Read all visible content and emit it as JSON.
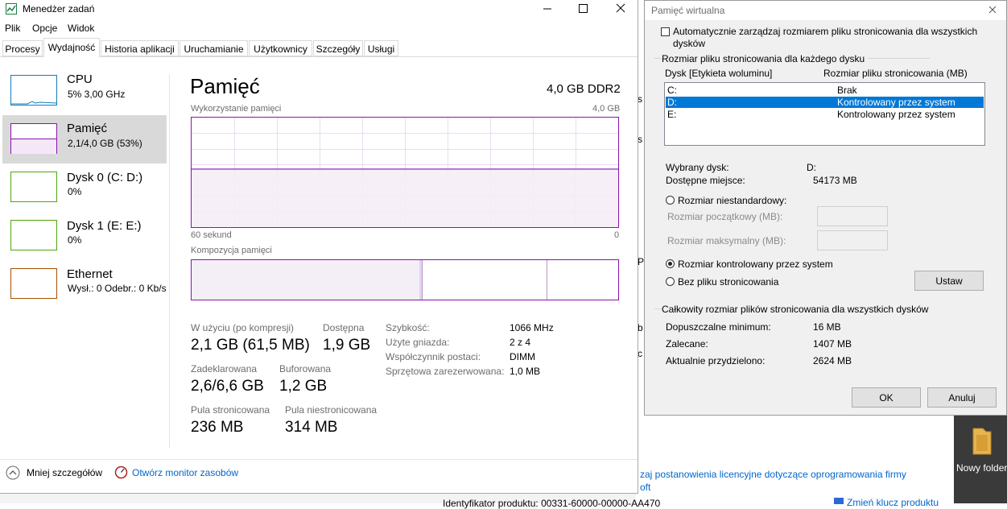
{
  "task_manager": {
    "title": "Menedżer zadań",
    "menu": [
      "Plik",
      "Opcje",
      "Widok"
    ],
    "tabs": [
      "Procesy",
      "Wydajność",
      "Historia aplikacji",
      "Uruchamianie",
      "Użytkownicy",
      "Szczegóły",
      "Usługi"
    ],
    "active_tab": "Wydajność",
    "sidebar": [
      {
        "name": "CPU",
        "detail": "5%  3,00 GHz",
        "color": "#117dbb"
      },
      {
        "name": "Pamięć",
        "detail": "2,1/4,0 GB (53%)",
        "color": "#8b12ae",
        "selected": true
      },
      {
        "name": "Dysk 0 (C: D:)",
        "detail": "0%",
        "color": "#4da60c"
      },
      {
        "name": "Dysk 1 (E: E:)",
        "detail": "0%",
        "color": "#4da60c"
      },
      {
        "name": "Ethernet",
        "detail": "Wysł.: 0  Odebr.: 0 Kb/s",
        "color": "#a74f01"
      }
    ],
    "memory": {
      "heading": "Pamięć",
      "capacity": "4,0 GB DDR2",
      "usage_label": "Wykorzystanie pamięci",
      "usage_max": "4,0 GB",
      "time_left": "60 sekund",
      "time_right": "0",
      "composition_label": "Kompozycja pamięci",
      "usage_fraction": 0.53,
      "stats": {
        "in_use_label": "W użyciu (po kompresji)",
        "in_use_value": "2,1 GB (61,5 MB)",
        "available_label": "Dostępna",
        "available_value": "1,9 GB",
        "committed_label": "Zadeklarowana",
        "committed_value": "2,6/6,6 GB",
        "cached_label": "Buforowana",
        "cached_value": "1,2 GB",
        "paged_label": "Pula stronicowana",
        "paged_value": "236 MB",
        "nonpaged_label": "Pula niestronicowana",
        "nonpaged_value": "314 MB"
      },
      "details": [
        {
          "label": "Szybkość:",
          "value": "1066 MHz"
        },
        {
          "label": "Użyte gniazda:",
          "value": "2 z 4"
        },
        {
          "label": "Współczynnik postaci:",
          "value": "DIMM"
        },
        {
          "label": "Sprzętowa zarezerwowana:",
          "value": "1,0 MB"
        }
      ]
    },
    "footer": {
      "fewer_details": "Mniej szczegółów",
      "resource_monitor": "Otwórz monitor zasobów"
    }
  },
  "dialog": {
    "title": "Pamięć wirtualna",
    "auto_manage": "Automatycznie zarządzaj rozmiarem pliku stronicowania dla wszystkich dysków",
    "group1_title": "Rozmiar pliku stronicowania dla każdego dysku",
    "col_drive": "Dysk [Etykieta woluminu]",
    "col_size": "Rozmiar pliku stronicowania (MB)",
    "drives": [
      {
        "drive": "C:",
        "size": "Brak"
      },
      {
        "drive": "D:",
        "size": "Kontrolowany przez system",
        "selected": true
      },
      {
        "drive": "E:",
        "size": "Kontrolowany przez system"
      }
    ],
    "selected_drive_label": "Wybrany dysk:",
    "selected_drive_value": "D:",
    "free_space_label": "Dostępne miejsce:",
    "free_space_value": "54173  MB",
    "custom_size": "Rozmiar niestandardowy:",
    "initial_size": "Rozmiar początkowy (MB):",
    "max_size": "Rozmiar maksymalny (MB):",
    "system_managed": "Rozmiar kontrolowany przez system",
    "no_paging": "Bez pliku stronicowania",
    "set_button": "Ustaw",
    "group2_title": "Całkowity rozmiar plików stronicowania dla wszystkich dysków",
    "min_label": "Dopuszczalne minimum:",
    "min_value": "16  MB",
    "rec_label": "Zalecane:",
    "rec_value": "1407  MB",
    "alloc_label": "Aktualnie przydzielono:",
    "alloc_value": "2624  MB",
    "ok": "OK",
    "cancel": "Anuluj"
  },
  "background": {
    "link1": "zaj postanowienia licencyjne dotyczące oprogramowania firmy",
    "link2": "oft",
    "product_id": "Identyfikator produktu:  00331-60000-00000-AA470",
    "change_key": "Zmień klucz produktu",
    "folder_label": "Nowy folder"
  }
}
